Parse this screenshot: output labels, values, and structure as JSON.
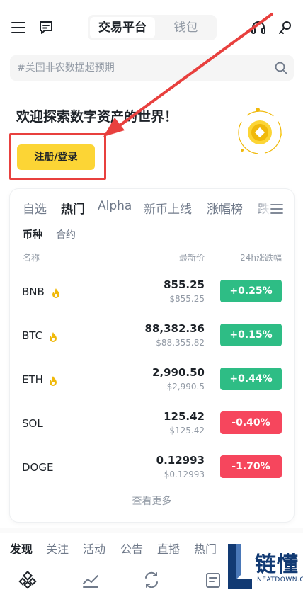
{
  "header": {
    "tabs": [
      "交易平台",
      "钱包"
    ],
    "active_tab": "交易平台"
  },
  "search": {
    "placeholder": "#美国非农数据超预期"
  },
  "welcome": {
    "title": "欢迎探索数字资产的世界！",
    "cta_label": "注册/登录"
  },
  "market": {
    "tabs": [
      "自选",
      "热门",
      "Alpha",
      "新币上线",
      "涨幅榜",
      "跌"
    ],
    "active_tab": "热门",
    "subtabs": [
      "币种",
      "合约"
    ],
    "active_subtab": "币种",
    "columns": {
      "name": "名称",
      "price": "最新价",
      "change": "24h涨跌幅"
    },
    "rows": [
      {
        "symbol": "BNB",
        "hot": true,
        "price": "855.25",
        "fiat": "$855.25",
        "change": "+0.25%",
        "direction": "up"
      },
      {
        "symbol": "BTC",
        "hot": true,
        "price": "88,382.36",
        "fiat": "$88,355.82",
        "change": "+0.15%",
        "direction": "up"
      },
      {
        "symbol": "ETH",
        "hot": true,
        "price": "2,990.50",
        "fiat": "$2,990.5",
        "change": "+0.44%",
        "direction": "up"
      },
      {
        "symbol": "SOL",
        "hot": false,
        "price": "125.42",
        "fiat": "$125.42",
        "change": "-0.40%",
        "direction": "down"
      },
      {
        "symbol": "DOGE",
        "hot": false,
        "price": "0.12993",
        "fiat": "$0.12993",
        "change": "-1.70%",
        "direction": "down"
      }
    ],
    "more_label": "查看更多"
  },
  "feed_tabs": [
    "发现",
    "关注",
    "活动",
    "公告",
    "直播",
    "热门"
  ],
  "active_feed_tab": "发现",
  "bottom_nav_icons": [
    "home-icon",
    "markets-icon",
    "trade-icon",
    "assets-icon"
  ],
  "watermark": {
    "cn": "链懂",
    "en": "NEATDOWN.COM"
  },
  "colors": {
    "accent": "#fcd535",
    "up": "#2ebd85",
    "down": "#f6465d",
    "annotation": "#e8403e",
    "text": "#1e2329",
    "muted": "#929aa5"
  }
}
